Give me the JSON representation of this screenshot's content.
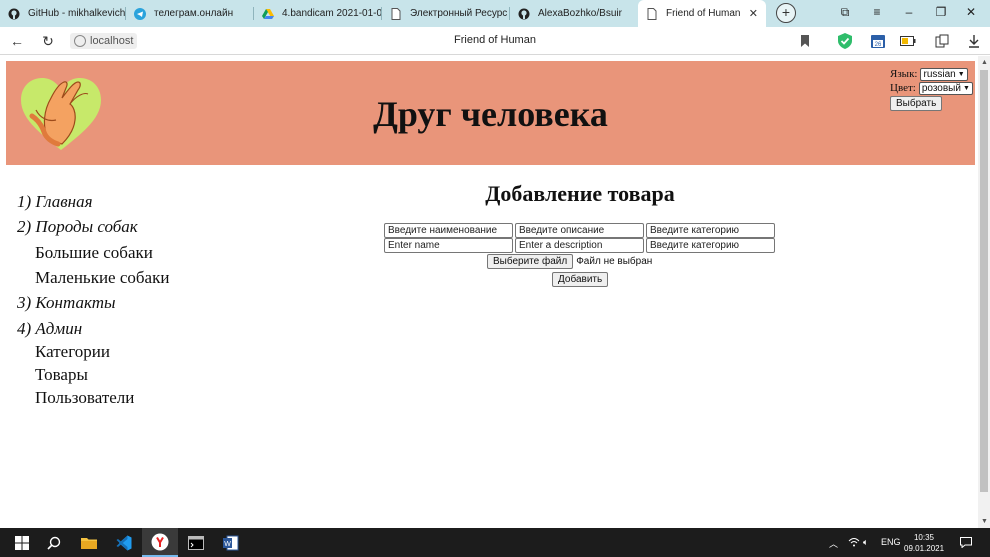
{
  "browser": {
    "tabs": [
      {
        "label": "GitHub - mikhalkevich",
        "icon": "github-icon"
      },
      {
        "label": "телеграм.онлайн",
        "icon": "telegram-icon"
      },
      {
        "label": "4.bandicam 2021-01-0",
        "icon": "google-drive-icon"
      },
      {
        "label": "Электронный Ресурс",
        "icon": "document-icon"
      },
      {
        "label": "AlexaBozhko/Bsuir",
        "icon": "github-icon"
      },
      {
        "label": "Friend of Human",
        "icon": "document-icon",
        "active": true
      }
    ],
    "new_tab": "+",
    "address_host": "localhost",
    "page_title": "Friend of Human",
    "extension_badge": "26"
  },
  "site": {
    "title": "Друг человека",
    "header_color": "#e9957a",
    "settings": {
      "language_label": "Язык:",
      "language_value": "russian",
      "color_label": "Цвет:",
      "color_value": "розовый",
      "apply_button": "Выбрать"
    },
    "menu": [
      {
        "label": "1) Главная",
        "italic": true
      },
      {
        "label": "2) Породы собак",
        "italic": true
      },
      {
        "label": "Большие собаки",
        "italic": false
      },
      {
        "label": "Маленькие собаки",
        "italic": false
      },
      {
        "label": "3) Контакты",
        "italic": true
      },
      {
        "label": "4) Админ",
        "italic": true
      },
      {
        "label": "Категории",
        "italic": false
      },
      {
        "label": "Товары",
        "italic": false
      },
      {
        "label": "Пользователи",
        "italic": false
      }
    ]
  },
  "form": {
    "title": "Добавление товара",
    "fields": {
      "name_ru": "Введите наименование",
      "description_ru": "Введите описание",
      "category_ru": "Введите категорию",
      "name_en": "Enter name",
      "description_en": "Enter a description",
      "category_2": "Введите категорию"
    },
    "file_button": "Выберите файл",
    "file_status": "Файл не выбран",
    "submit": "Добавить"
  },
  "taskbar": {
    "lang": "ENG",
    "time": "10:35",
    "date": "09.01.2021"
  }
}
